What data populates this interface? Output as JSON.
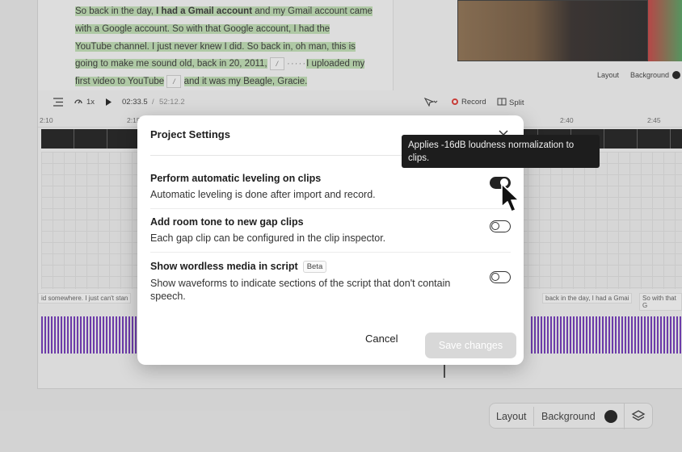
{
  "script": {
    "lines": [
      {
        "pre": "So back in the day, ",
        "bold": "I had a Gmail account",
        "post": " and my Gmail account came"
      },
      {
        "text": "with a Google account. So with that Google account, I had the"
      },
      {
        "text": "YouTube channel. I just never knew I did. So back in, oh man, this is"
      },
      {
        "pre": "going to make me sound old, back in 20, 2011,",
        "post": "I uploaded my"
      },
      {
        "pre": "first video to YouTube",
        "post": "and it was my Beagle, Gracie."
      }
    ],
    "token_glyph": "/",
    "dots": "·····"
  },
  "preview": {
    "layout_label": "Layout",
    "background_label": "Background"
  },
  "transport": {
    "speed": "1x",
    "current_time": "02:33.5",
    "separator": "/",
    "total_time": "52:12.2",
    "record_label": "Record",
    "split_label": "Split"
  },
  "ruler": {
    "ticks": [
      "2:10",
      "2:15",
      "2:40",
      "2:45"
    ]
  },
  "clips": {
    "labels": [
      "id somewhere. I just can't stan",
      "back in the day, I had a Gmai",
      "So with that G"
    ]
  },
  "bottom_toolbar": {
    "layout_label": "Layout",
    "background_label": "Background"
  },
  "modal": {
    "title": "Project Settings",
    "settings": [
      {
        "title": "Perform automatic leveling on clips",
        "desc": "Automatic leveling is done after import and record.",
        "enabled": true
      },
      {
        "title": "Add room tone to new gap clips",
        "desc": "Each gap clip can be configured in the clip inspector.",
        "enabled": false
      },
      {
        "title": "Show wordless media in script",
        "badge": "Beta",
        "desc": "Show waveforms to indicate sections of the script that don't contain speech.",
        "enabled": false
      }
    ],
    "cancel_label": "Cancel",
    "save_label": "Save changes"
  },
  "tooltip": {
    "text": "Applies -16dB loudness normalization to clips."
  },
  "colors": {
    "highlight": "#bfe0b2",
    "waveform": "#6a2bb8",
    "record": "#e0302a",
    "tooltip_bg": "#1d1d1d",
    "save_disabled": "#d8d8d8"
  }
}
